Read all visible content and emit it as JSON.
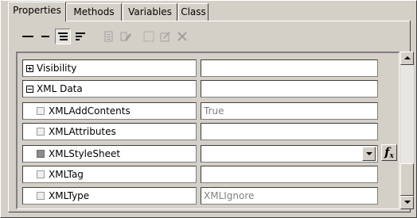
{
  "tabs": [
    {
      "label": "Properties",
      "active": true
    },
    {
      "label": "Methods",
      "active": false
    },
    {
      "label": "Variables",
      "active": false
    },
    {
      "label": "Class",
      "active": false
    }
  ],
  "toolbar": {
    "buttons": [
      {
        "icon": "collapse-all-icon",
        "pressed": false,
        "enabled": true
      },
      {
        "icon": "collapse-icon",
        "pressed": false,
        "enabled": true
      },
      {
        "icon": "categorized-view-icon",
        "pressed": true,
        "enabled": true
      },
      {
        "icon": "alphabetical-view-icon",
        "pressed": false,
        "enabled": true
      },
      {
        "icon": "properties-list-icon",
        "pressed": false,
        "enabled": false
      },
      {
        "icon": "edit-property-icon",
        "pressed": false,
        "enabled": false
      },
      {
        "icon": "new-property-icon",
        "pressed": false,
        "enabled": false
      },
      {
        "icon": "modify-icon",
        "pressed": false,
        "enabled": false
      },
      {
        "icon": "delete-icon",
        "pressed": false,
        "enabled": false
      }
    ]
  },
  "properties": [
    {
      "name": "Visibility",
      "value": "",
      "kind": "group",
      "expanded": false
    },
    {
      "name": "XML Data",
      "value": "",
      "kind": "group",
      "expanded": true
    },
    {
      "name": "XMLAddContents",
      "value": "True",
      "kind": "item"
    },
    {
      "name": "XMLAttributes",
      "value": "",
      "kind": "item"
    },
    {
      "name": "XMLStyleSheet",
      "value": "",
      "kind": "item",
      "selected": true,
      "dropdown": true
    },
    {
      "name": "XMLTag",
      "value": "",
      "kind": "item"
    },
    {
      "name": "XMLType",
      "value": "XMLIgnore",
      "kind": "item"
    }
  ],
  "function_button": {
    "label": "f",
    "sub": "x"
  },
  "colors": {
    "face": "#d4d0c8",
    "value_text": "#808080",
    "cell": "#ffffff"
  }
}
